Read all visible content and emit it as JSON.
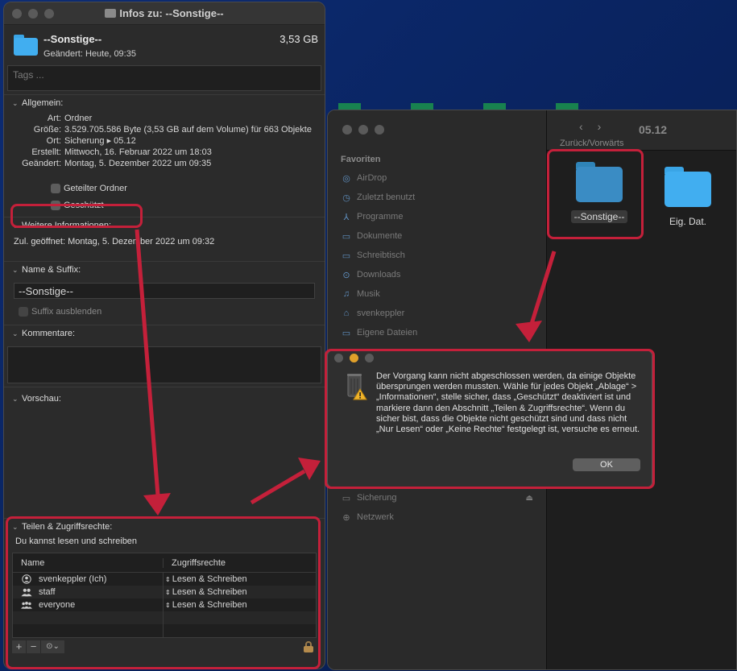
{
  "info_window": {
    "title": "Infos zu: --Sonstige--",
    "name": "--Sonstige--",
    "size": "3,53 GB",
    "modified": "Geändert: Heute, 09:35",
    "tags_placeholder": "Tags ...",
    "general": {
      "heading": "Allgemein:",
      "rows": [
        {
          "k": "Art:",
          "v": "Ordner"
        },
        {
          "k": "Größe:",
          "v": "3.529.705.586 Byte (3,53 GB auf dem Volume) für 663 Objekte"
        },
        {
          "k": "Ort:",
          "v": "Sicherung ▸ 05.12"
        },
        {
          "k": "Erstellt:",
          "v": "Mittwoch, 16. Februar 2022 um 18:03"
        },
        {
          "k": "Geändert:",
          "v": "Montag, 5. Dezember 2022 um 09:35"
        }
      ],
      "shared_folder": "Geteilter Ordner",
      "locked": "Geschützt"
    },
    "more_info": {
      "heading": "Weitere Informationen:",
      "last_opened": "Zul. geöffnet: Montag, 5. Dezember 2022 um 09:32"
    },
    "name_ext": {
      "heading": "Name & Suffix:",
      "value": "--Sonstige--",
      "hide_ext": "Suffix ausblenden"
    },
    "comments": {
      "heading": "Kommentare:"
    },
    "preview": {
      "heading": "Vorschau:"
    },
    "sharing": {
      "heading": "Teilen & Zugriffsrechte:",
      "status": "Du kannst lesen und schreiben",
      "col_name": "Name",
      "col_priv": "Zugriffsrechte",
      "rows": [
        {
          "name": "svenkeppler (Ich)",
          "priv": "Lesen & Schreiben"
        },
        {
          "name": "staff",
          "priv": "Lesen & Schreiben"
        },
        {
          "name": "everyone",
          "priv": "Lesen & Schreiben"
        }
      ]
    }
  },
  "finder": {
    "title": "05.12",
    "nav_label": "Zurück/Vorwärts",
    "favorites_heading": "Favoriten",
    "favorites": [
      {
        "label": "AirDrop",
        "icon": "airdrop-icon"
      },
      {
        "label": "Zuletzt benutzt",
        "icon": "clock-icon"
      },
      {
        "label": "Programme",
        "icon": "apps-icon"
      },
      {
        "label": "Dokumente",
        "icon": "document-icon"
      },
      {
        "label": "Schreibtisch",
        "icon": "desktop-icon"
      },
      {
        "label": "Downloads",
        "icon": "download-icon"
      },
      {
        "label": "Musik",
        "icon": "music-icon"
      },
      {
        "label": "svenkeppler",
        "icon": "home-icon"
      },
      {
        "label": "Eigene Dateien",
        "icon": "folder-icon"
      }
    ],
    "locations": [
      {
        "label": "Sicherung",
        "icon": "drive-icon"
      },
      {
        "label": "Netzwerk",
        "icon": "globe-icon"
      }
    ],
    "items": [
      "--Sonstige--",
      "Eig. Dat."
    ]
  },
  "alert": {
    "message": "Der Vorgang kann nicht abgeschlossen werden, da einige Objekte übersprungen werden mussten. Wähle für jedes Objekt „Ablage“ > „Informationen“, stelle sicher, dass „Geschützt“ deaktiviert ist und markiere dann den Abschnitt „Teilen & Zugriffsrechte“. Wenn du sicher bist, dass die Objekte nicht geschützt sind und dass nicht „Nur Lesen“ oder „Keine Rechte“ festgelegt ist, versuche es erneut.",
    "ok": "OK"
  },
  "colors": {
    "annotation": "#c4203a",
    "folder": "#41aef0",
    "warning": "#e0a02a"
  }
}
